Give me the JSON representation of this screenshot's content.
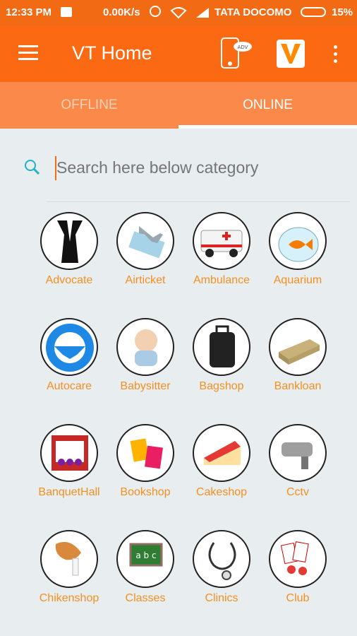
{
  "status_bar": {
    "time": "12:33 PM",
    "speed": "0.00K/s",
    "carrier": "TATA DOCOMO",
    "battery": "15%"
  },
  "app_bar": {
    "title": "VT Home"
  },
  "tabs": [
    {
      "label": "OFFLINE",
      "selected": false
    },
    {
      "label": "ONLINE",
      "selected": true
    }
  ],
  "search": {
    "placeholder": "Search here below category",
    "value": ""
  },
  "categories": [
    {
      "label": "Advocate"
    },
    {
      "label": "Airticket"
    },
    {
      "label": "Ambulance"
    },
    {
      "label": "Aquarium"
    },
    {
      "label": "Autocare"
    },
    {
      "label": "Babysitter"
    },
    {
      "label": "Bagshop"
    },
    {
      "label": "Bankloan"
    },
    {
      "label": "BanquetHall"
    },
    {
      "label": "Bookshop"
    },
    {
      "label": "Cakeshop"
    },
    {
      "label": "Cctv"
    },
    {
      "label": "Chikenshop"
    },
    {
      "label": "Classes"
    },
    {
      "label": "Clinics"
    },
    {
      "label": "Club"
    }
  ],
  "icons": {
    "status_time": "gmail-icon",
    "app_bar_ad": "phone-ad-icon",
    "app_bar_logo": "vt-logo-icon"
  }
}
